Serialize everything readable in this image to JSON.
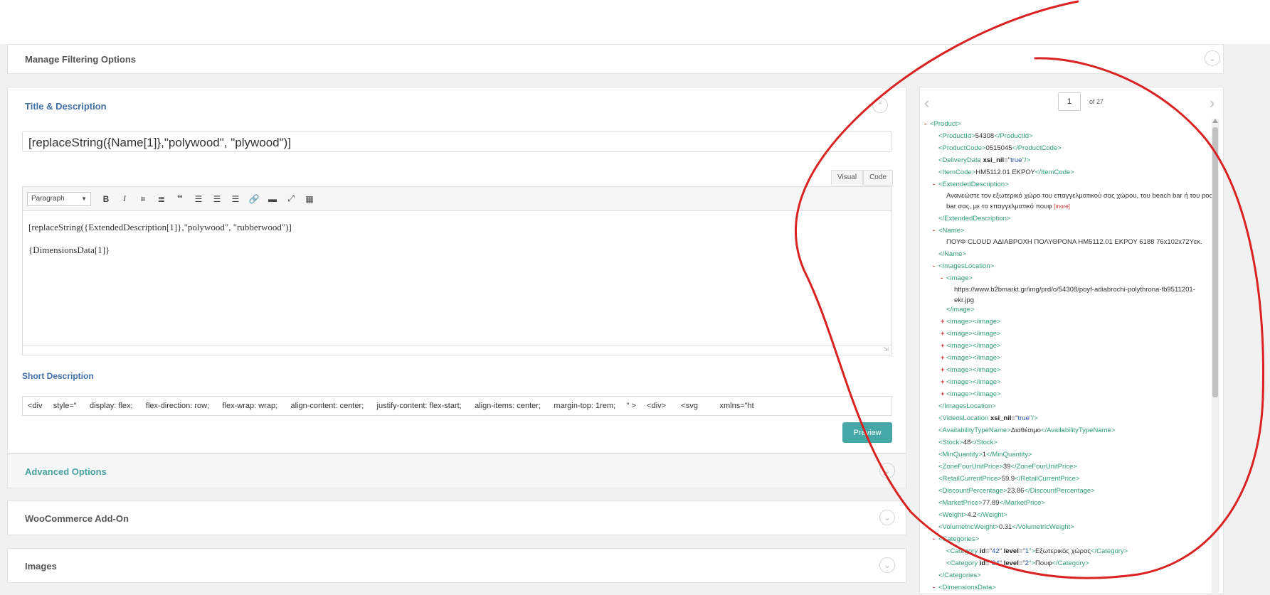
{
  "sections": {
    "filtering": "Manage Filtering Options",
    "title_desc": "Title & Description",
    "advanced": "Advanced Options",
    "woocommerce": "WooCommerce Add-On",
    "images": "Images"
  },
  "title_field": {
    "value": "[replaceString({Name[1]},\"polywood\", \"plywood\")]"
  },
  "editor": {
    "tabs": [
      "Visual",
      "Code"
    ],
    "format_select": "Paragraph",
    "toolbar_icons": [
      "bold-icon",
      "italic-icon",
      "bullet-list-icon",
      "numbered-list-icon",
      "blockquote-icon",
      "align-left-icon",
      "align-center-icon",
      "align-right-icon",
      "link-icon",
      "read-more-icon",
      "fullscreen-icon",
      "toolbar-toggle-icon"
    ],
    "lines": [
      "[replaceString({ExtendedDescription[1]},\"polywood\", \"rubberwood\")]",
      "{DimensionsData[1]}"
    ]
  },
  "short_description": {
    "label": "Short Description",
    "value": "<div     style=\"      display: flex;      flex-direction: row;      flex-wrap: wrap;      align-content: center;      justify-content: flex-start;      align-items: center;      margin-top: 1rem;     \" >     <div>       <svg          xmlns=\"ht"
  },
  "preview_button": "Preview",
  "xml_viewer": {
    "page": "1",
    "of_label": "of 27",
    "nodes": {
      "product": "<Product>",
      "product_id": [
        "<ProductId>",
        "54308",
        "</ProductId>"
      ],
      "product_code": [
        "<ProductCode>",
        "0515045",
        "</ProductCode>"
      ],
      "delivery_date": [
        "<DeliveryDate",
        "xsi_nil",
        "=\"",
        "true",
        "\"/>"
      ],
      "item_code": [
        "<ItemCode>",
        "HM5112.01 ΕΚΡΟΥ",
        "</ItemCode>"
      ],
      "ext_desc_open": "<ExtendedDescription>",
      "ext_desc_text": "Ανανεώστε τον εξωτερικό χώρο του επαγγελματικού σας χώρου, του beach bar ή του pool bar σας, με το επαγγελματικό πουφ",
      "more": "[more]",
      "ext_desc_close": "</ExtendedDescription>",
      "name_open": "<Name>",
      "name_text": "ΠΟΥΦ CLOUD ΑΔΙΑΒΡΟΧΗ ΠΟΛΥΘΡΟΝΑ HM5112.01 ΕΚΡΟΥ 6188 76x102x72Υεκ.",
      "name_close": "</Name>",
      "images_open": "<ImagesLocation>",
      "image_open": "<image>",
      "image_url": "https://www.b2bmarkt.gr/img/prd/o/54308/poyf-adiabrochi-polythrona-fb9511201-ekr.jpg",
      "image_close": "</image>",
      "image_collapsed": [
        "<image>",
        "</image>"
      ],
      "images_close": "</ImagesLocation>",
      "videos": [
        "<VideosLocation",
        "xsi_nil",
        "=\"",
        "true",
        "\"/>"
      ],
      "availability": [
        "<AvailabilityTypeName>",
        "Διαθέσιμο",
        "</AvailabilityTypeName>"
      ],
      "stock": [
        "<Stock>",
        "48",
        "</Stock>"
      ],
      "min_qty": [
        "<MinQuantity>",
        "1",
        "</MinQuantity>"
      ],
      "zone_price": [
        "<ZoneFourUnitPrice>",
        "39",
        "</ZoneFourUnitPrice>"
      ],
      "retail_price": [
        "<RetailCurrentPrice>",
        "59.9",
        "</RetailCurrentPrice>"
      ],
      "discount": [
        "<DiscountPercentage>",
        "23.86",
        "</DiscountPercentage>"
      ],
      "market_price": [
        "<MarketPrice>",
        "77.89",
        "</MarketPrice>"
      ],
      "weight": [
        "<Weight>",
        "4.2",
        "</Weight>"
      ],
      "vol_weight": [
        "<VolumetricWeight>",
        "0.31",
        "</VolumetricWeight>"
      ],
      "categories_open": "<Categories>",
      "cat1": [
        "<Category",
        "id",
        "=\"",
        "42",
        "\"",
        "level",
        "=\"",
        "1",
        "\">",
        "Εξωτερικός χώρος",
        "</Category>"
      ],
      "cat2": [
        "<Category",
        "id",
        "=\"",
        "84",
        "\"",
        "level",
        "=\"",
        "2",
        "\">",
        "Πουφ",
        "</Category>"
      ],
      "categories_close": "</Categories>",
      "dimensions_open": "<DimensionsData>"
    },
    "toggles": {
      "minus": "-",
      "plus": "+"
    }
  },
  "colors": {
    "annotation_red": "#d92222",
    "teal": "#46a8a6",
    "link_blue": "#3f6fa5",
    "xml_tag": "#2f9d7a"
  }
}
